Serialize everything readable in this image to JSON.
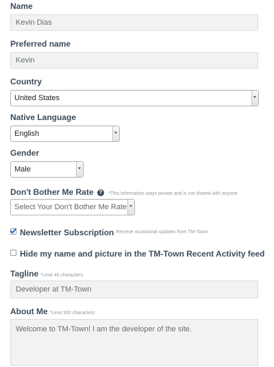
{
  "name": {
    "label": "Name",
    "value": "Kevin Dias"
  },
  "preferred_name": {
    "label": "Preferred name",
    "value": "Kevin"
  },
  "country": {
    "label": "Country",
    "value": "United States"
  },
  "native_language": {
    "label": "Native Language",
    "value": "English"
  },
  "gender": {
    "label": "Gender",
    "value": "Male"
  },
  "dont_bother": {
    "label": "Don't Bother Me Rate",
    "hint": "*This information stays private and is not shared with anyone",
    "placeholder": "Select Your Don't Bother Me Rate",
    "help_glyph": "?"
  },
  "newsletter": {
    "label": "Newsletter Subscription",
    "hint": "Receive occasional updates from TM-Town",
    "checked": true
  },
  "hide_activity": {
    "label": "Hide my name and picture in the TM-Town Recent Activity feed",
    "checked": false
  },
  "tagline": {
    "label": "Tagline",
    "hint": "*Limit 45 characters",
    "value": "Developer at TM-Town"
  },
  "about_me": {
    "label": "About Me",
    "hint": "*Limit 300 characters",
    "value": "Welcome to TM-Town! I am the developer of the site."
  },
  "colors": {
    "label_text": "#3d4c5a",
    "field_background": "#f2f2f2",
    "checkbox_check": "#1f6fb8"
  }
}
